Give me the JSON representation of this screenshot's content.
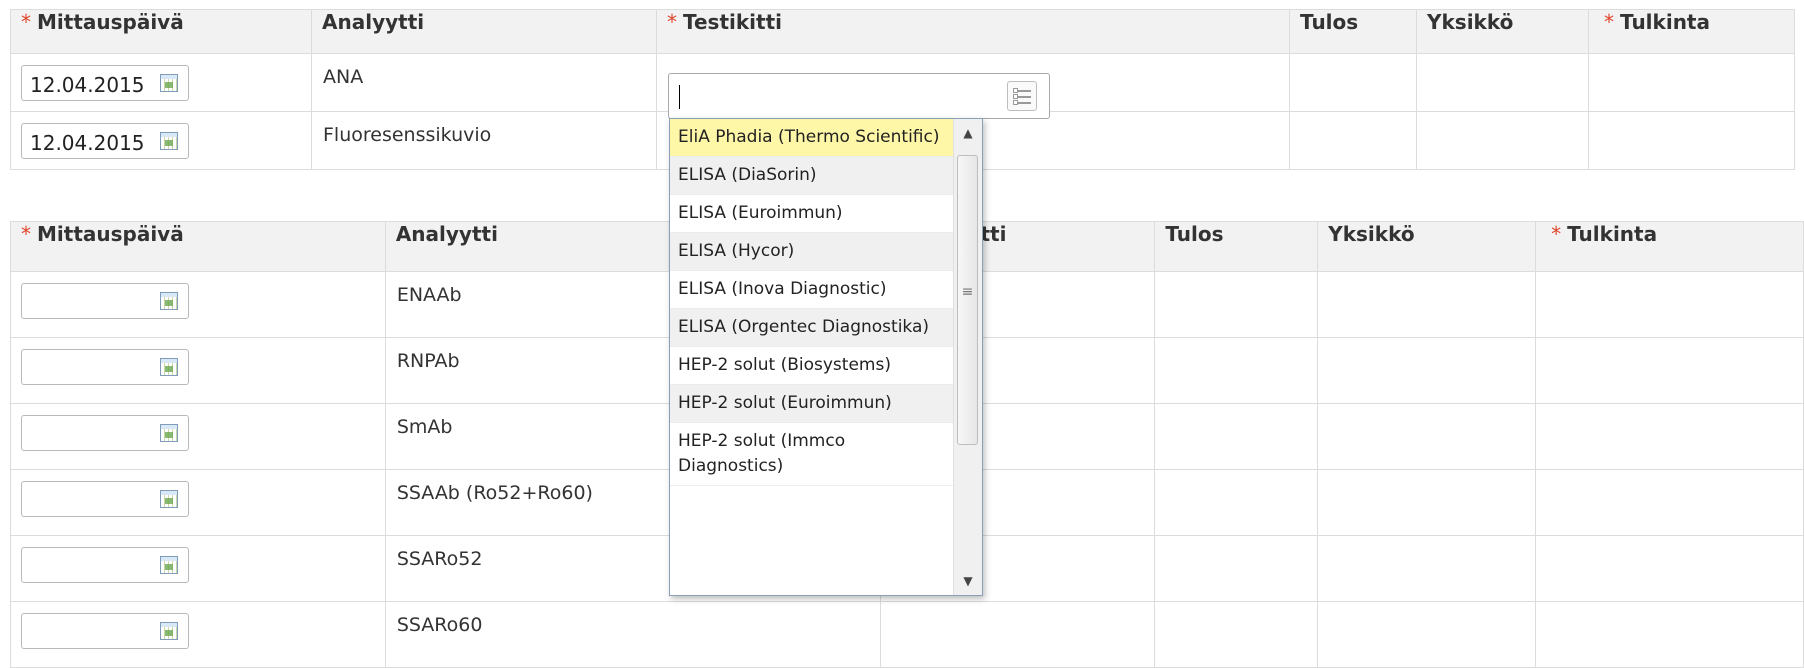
{
  "table1": {
    "headers": {
      "date": "Mittauspäivä",
      "analyte": "Analyytti",
      "kit": "Testikitti",
      "result": "Tulos",
      "unit": "Yksikkö",
      "interpretation": "Tulkinta"
    },
    "required_marker": "*",
    "rows": [
      {
        "date": "12.04.2015",
        "analyte": "ANA"
      },
      {
        "date": "12.04.2015",
        "analyte": "Fluoresenssikuvio"
      }
    ]
  },
  "kit_combobox": {
    "value": "",
    "icon": "list-icon",
    "options": [
      "EliA Phadia (Thermo Scientific)",
      "ELISA (DiaSorin)",
      "ELISA (Euroimmun)",
      "ELISA (Hycor)",
      "ELISA (Inova Diagnostic)",
      "ELISA (Orgentec Diagnostika)",
      "HEP-2 solut (Biosystems)",
      "HEP-2 solut (Euroimmun)",
      "HEP-2 solut (Immco Diagnostics)"
    ],
    "highlighted_index": 0
  },
  "table2": {
    "headers": {
      "date": "Mittauspäivä",
      "analyte": "Analyytti",
      "kit": "Testikitti",
      "result": "Tulos",
      "unit": "Yksikkö",
      "interpretation": "Tulkinta"
    },
    "required_marker": "*",
    "rows": [
      {
        "date": "",
        "analyte": "ENAAb"
      },
      {
        "date": "",
        "analyte": "RNPAb"
      },
      {
        "date": "",
        "analyte": "SmAb"
      },
      {
        "date": "",
        "analyte": "SSAAb (Ro52+Ro60)"
      },
      {
        "date": "",
        "analyte": "SSARo52"
      },
      {
        "date": "",
        "analyte": "SSARo60"
      }
    ]
  },
  "colors": {
    "required": "#e0442b",
    "header_bg": "#f2f2f2",
    "border": "#dcdcdc",
    "highlight": "#fff7a8"
  }
}
